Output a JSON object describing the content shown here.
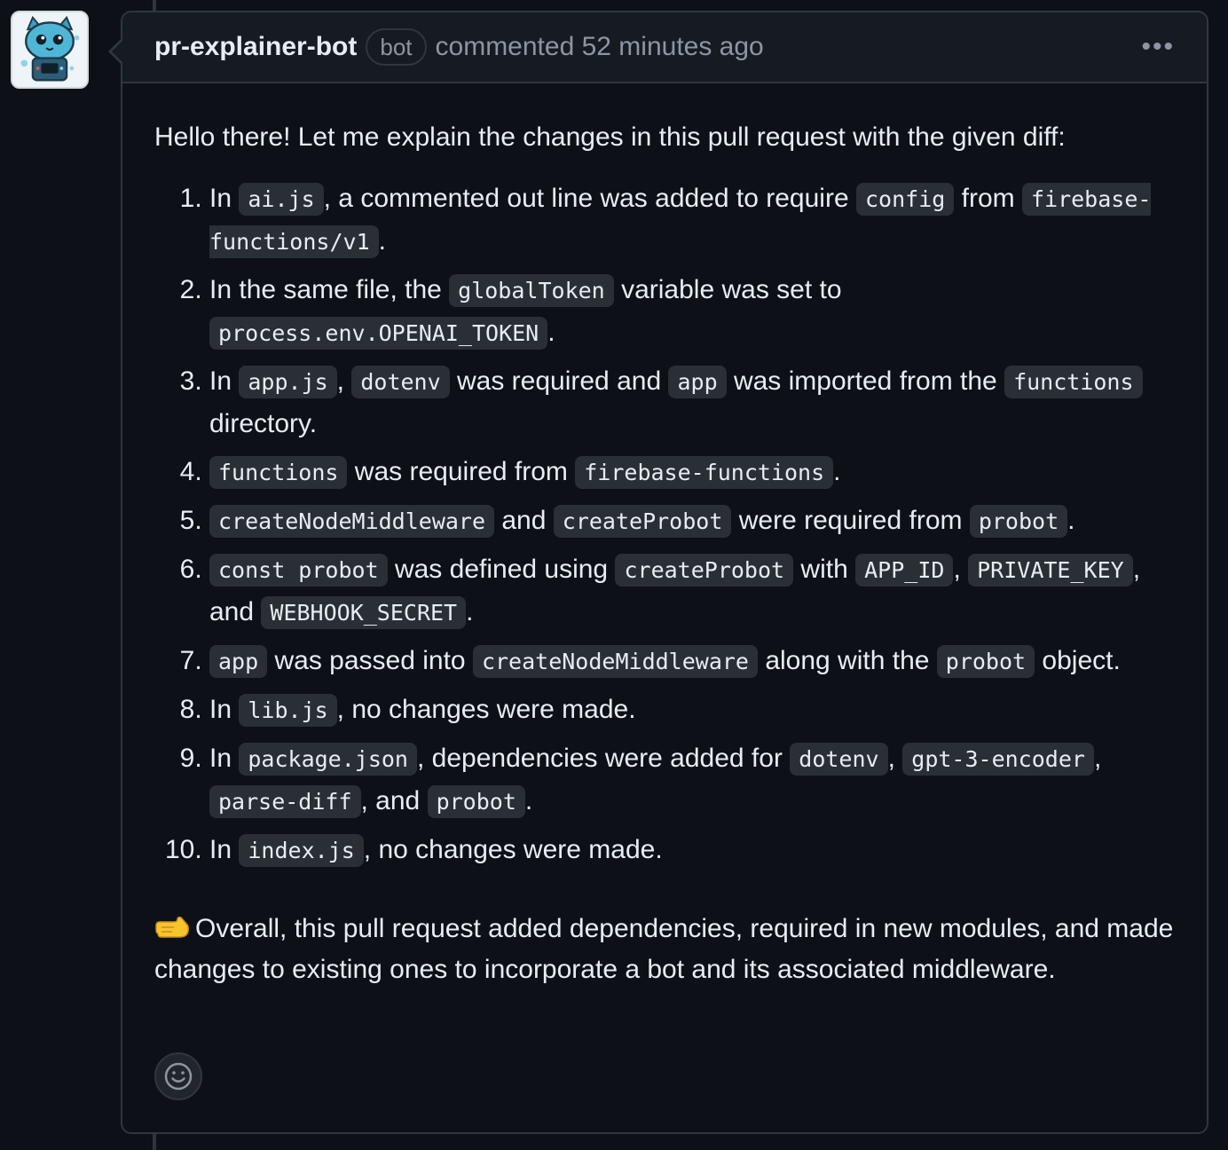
{
  "header": {
    "author": "pr-explainer-bot",
    "badge": "bot",
    "meta": "commented 52 minutes ago",
    "more_label": "•••"
  },
  "body": {
    "intro": "Hello there! Let me explain the changes in this pull request with the given diff:",
    "items": [
      [
        "In ",
        {
          "code": "ai.js"
        },
        ", a commented out line was added to require ",
        {
          "code": "config"
        },
        " from ",
        {
          "code": "firebase-functions/v1"
        },
        "."
      ],
      [
        "In the same file, the ",
        {
          "code": "globalToken"
        },
        " variable was set to ",
        {
          "code": "process.env.OPENAI_TOKEN"
        },
        "."
      ],
      [
        "In ",
        {
          "code": "app.js"
        },
        ", ",
        {
          "code": "dotenv"
        },
        " was required and ",
        {
          "code": "app"
        },
        " was imported from the ",
        {
          "code": "functions"
        },
        " directory."
      ],
      [
        {
          "code": "functions"
        },
        " was required from ",
        {
          "code": "firebase-functions"
        },
        "."
      ],
      [
        {
          "code": "createNodeMiddleware"
        },
        " and ",
        {
          "code": "createProbot"
        },
        " were required from ",
        {
          "code": "probot"
        },
        "."
      ],
      [
        {
          "code": "const probot"
        },
        " was defined using ",
        {
          "code": "createProbot"
        },
        " with ",
        {
          "code": "APP_ID"
        },
        ", ",
        {
          "code": "PRIVATE_KEY"
        },
        ", and ",
        {
          "code": "WEBHOOK_SECRET"
        },
        "."
      ],
      [
        {
          "code": "app"
        },
        " was passed into ",
        {
          "code": "createNodeMiddleware"
        },
        " along with the ",
        {
          "code": "probot"
        },
        " object."
      ],
      [
        "In ",
        {
          "code": "lib.js"
        },
        ", no changes were made."
      ],
      [
        "In ",
        {
          "code": "package.json"
        },
        ", dependencies were added for ",
        {
          "code": "dotenv"
        },
        ", ",
        {
          "code": "gpt-3-encoder"
        },
        ", ",
        {
          "code": "parse-diff"
        },
        ", and ",
        {
          "code": "probot"
        },
        "."
      ],
      [
        "In ",
        {
          "code": "index.js"
        },
        ", no changes were made."
      ]
    ],
    "summary": "Overall, this pull request added dependencies, required in new modules, and made changes to existing ones to incorporate a bot and its associated middleware."
  },
  "icons": {
    "avatar": "robot-cat-avatar",
    "pointer": "pointing-hand-emoji-icon",
    "reaction": "smiley-icon",
    "more": "kebab-horizontal-icon"
  },
  "colors": {
    "background": "#0d1117",
    "header_bg": "#161b22",
    "border": "#30363d",
    "muted": "#8d96a0",
    "code_bg": "#2a2f36"
  }
}
